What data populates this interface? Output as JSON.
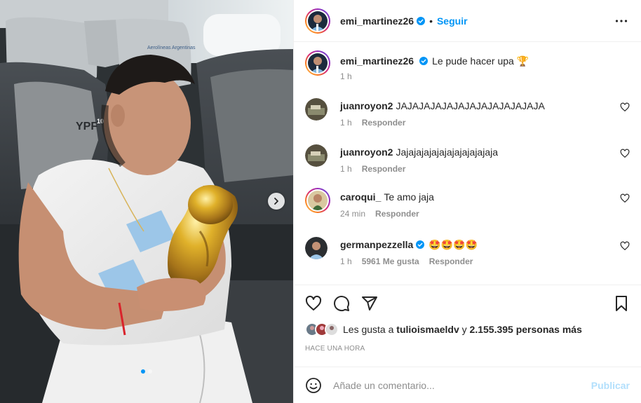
{
  "post": {
    "author": "emi_martinez26",
    "follow_label": "Seguir",
    "separator": "•",
    "caption": "Le pude hacer upa",
    "caption_emoji": "🏆",
    "caption_time": "1 h",
    "image_text": {
      "seat_logo": "Aerolíneas Argentinas",
      "seat_brand": "YPF",
      "seat_brand_prefix": "100"
    }
  },
  "comments": [
    {
      "user": "juanroyon2",
      "text": "JAJAJAJAJAJAJAJAJAJAJAJAJA",
      "time": "1 h",
      "reply": "Responder",
      "likes": ""
    },
    {
      "user": "juanroyon2",
      "text": "Jajajajajajajajajajajajaja",
      "time": "1 h",
      "reply": "Responder",
      "likes": ""
    },
    {
      "user": "caroqui_",
      "text": "Te amo jaja",
      "time": "24 min",
      "reply": "Responder",
      "likes": ""
    },
    {
      "user": "germanpezzella",
      "text": "🤩🤩🤩🤩",
      "time": "1 h",
      "reply": "Responder",
      "likes": "5961 Me gusta"
    }
  ],
  "likes": {
    "prefix": "Les gusta a",
    "first_user": "tulioismaeldv",
    "middle": "y",
    "others": "2.155.395 personas más"
  },
  "timestamp": "HACE UNA HORA",
  "add_comment": {
    "placeholder": "Añade un comentario...",
    "publish_label": "Publicar"
  },
  "carousel": {
    "total": 2,
    "active": 1
  },
  "colors": {
    "accent": "#0095f6",
    "publish_disabled": "#b2dffc",
    "verified": "#0095f6",
    "muted": "#8e8e8e"
  },
  "icons": [
    "more-horizontal-icon",
    "heart-icon",
    "comment-icon",
    "share-icon",
    "bookmark-icon",
    "emoji-icon",
    "verified-icon",
    "chevron-right-icon"
  ]
}
